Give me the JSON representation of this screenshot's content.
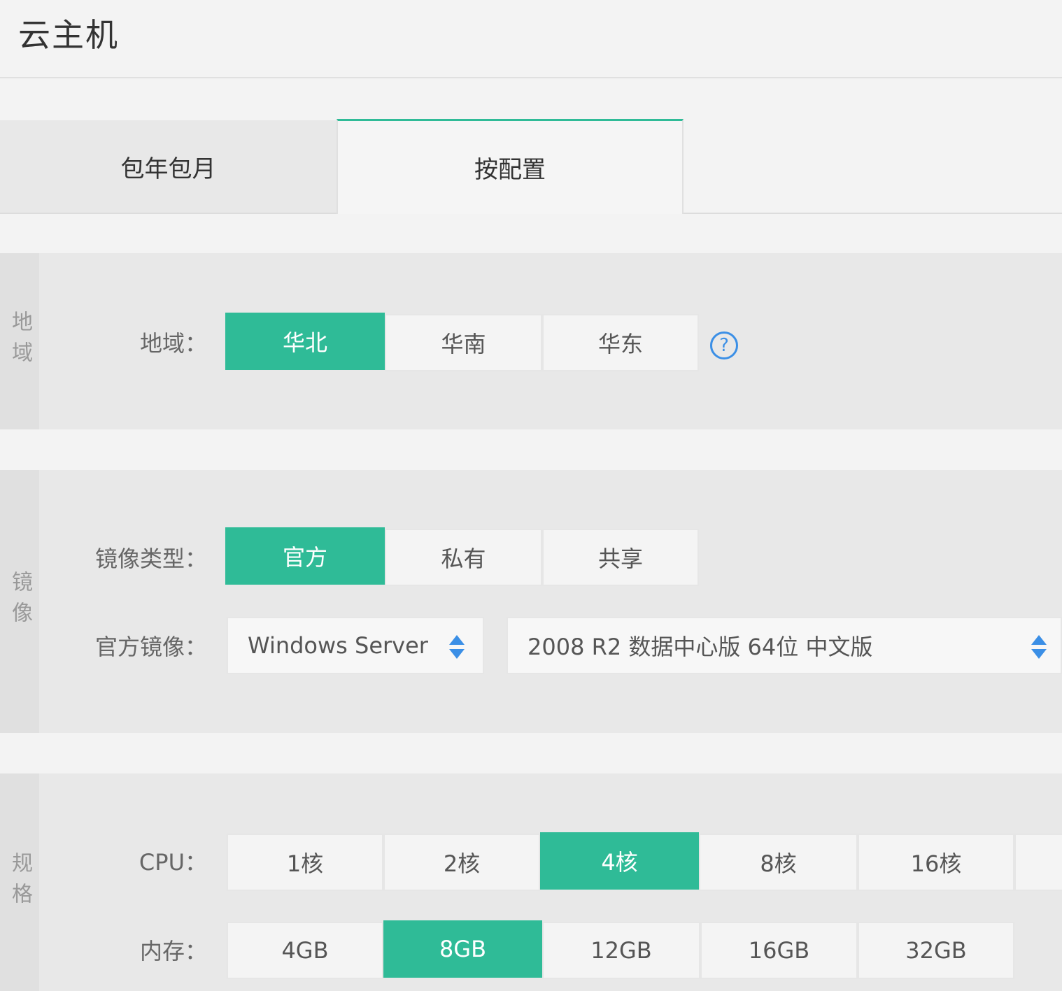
{
  "page": {
    "title": "云主机"
  },
  "tabs": [
    {
      "label": "包年包月",
      "active": false
    },
    {
      "label": "按配置",
      "active": true
    }
  ],
  "region": {
    "side_label": "地域",
    "label": "地域：",
    "options": [
      "华北",
      "华南",
      "华东"
    ],
    "selected": "华北",
    "help_icon": "question-circle-icon",
    "help_glyph": "?"
  },
  "image": {
    "side_label": "镜像",
    "type_label": "镜像类型：",
    "type_options": [
      "官方",
      "私有",
      "共享"
    ],
    "type_selected": "官方",
    "official_label": "官方镜像：",
    "os_select_value": "Windows Server",
    "version_select_value": "2008 R2 数据中心版 64位 中文版"
  },
  "spec": {
    "side_label": "规格",
    "cpu_label": "CPU：",
    "cpu_options": [
      "1核",
      "2核",
      "4核",
      "8核",
      "16核"
    ],
    "cpu_selected": "4核",
    "memory_label": "内存：",
    "memory_options": [
      "4GB",
      "8GB",
      "12GB",
      "16GB",
      "32GB"
    ],
    "memory_selected": "8GB"
  },
  "colors": {
    "accent": "#2fbb97",
    "help": "#3b8fe6",
    "background": "#f3f3f3",
    "section": "#e8e8e8"
  }
}
